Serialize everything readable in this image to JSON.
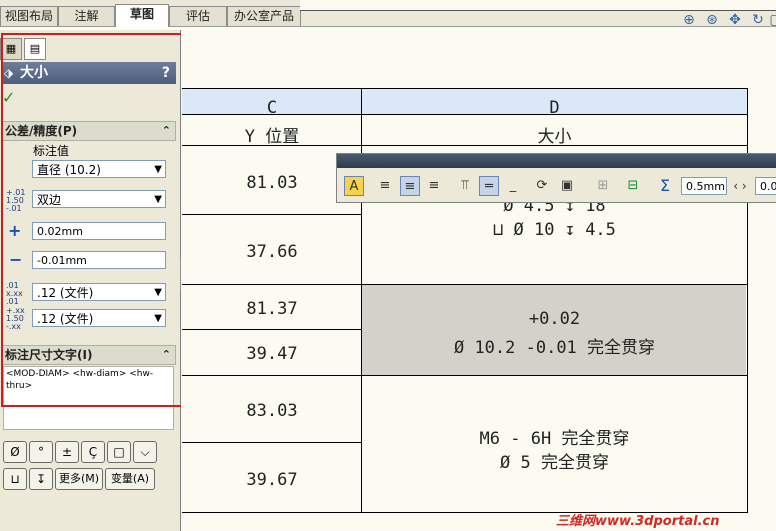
{
  "tabs": [
    "视图布局",
    "注解",
    "草图",
    "评估",
    "办公室产品"
  ],
  "active_tab": "草图",
  "panel": {
    "title": "大小",
    "help": "?",
    "confirm_icon": "checkmark-icon",
    "tolerance_header": "公差/精度(P)",
    "annotation_value_label": "标注值",
    "annotation_value": "直径 (10.2)",
    "tolerance_type": "双边",
    "tol_icon_text": "1.50",
    "upper": "0.02mm",
    "lower": "-0.01mm",
    "precision1": ".12 (文件)",
    "precision2": ".12 (文件)",
    "dim_text_header": "标注尺寸文字(I)",
    "dim_text_content": "<MOD-DIAM> <hw-diam> <hw-thru>",
    "sym_buttons": [
      "Ø",
      "°",
      "±",
      "Ç",
      "□",
      "⌵"
    ],
    "sym_buttons2": [
      "⊔",
      "↧"
    ],
    "more_button": "更多(M)",
    "variable_button": "变量(A)"
  },
  "table": {
    "col_c": "C",
    "col_d": "D",
    "y_pos": "Y 位置",
    "size": "大小",
    "rows": [
      "81.03",
      "37.66",
      "81.37",
      "39.47",
      "83.03",
      "39.67"
    ],
    "d_row1_line1": "Ø 4.5 ↧ 18",
    "d_row1_line2": "⊔ Ø 10 ↧ 4.5",
    "d_row2_line1": "+0.02",
    "d_row2_line2": "Ø 10.2 -0.01 完全贯穿",
    "d_row3_line1": "M6 - 6H 完全贯穿",
    "d_row3_line2": "Ø 5 完全贯穿"
  },
  "format_toolbar": {
    "width_value": "0.5mm",
    "second_value": "0.0"
  },
  "watermark": "三维网www.3dportal.cn",
  "colors": {
    "header_blue": "#dbe8f8",
    "highlight_gray": "#d4d2c8",
    "red_box": "#d21c1c"
  }
}
